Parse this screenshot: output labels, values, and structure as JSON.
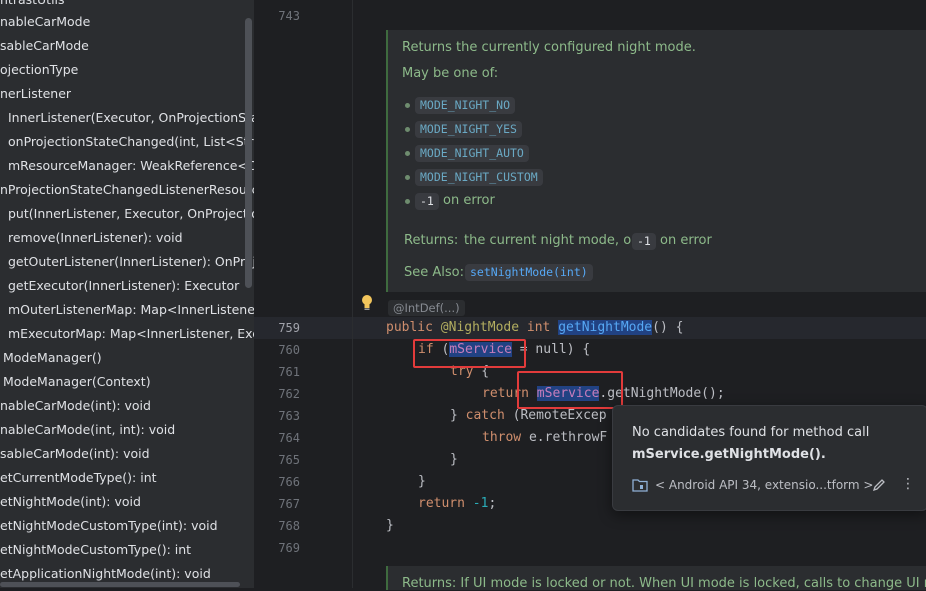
{
  "structure": {
    "items": [
      "ntrastUtils",
      "nableCarMode",
      "sableCarMode",
      "ojectionType",
      "nerListener",
      "InnerListener(Executor, OnProjectionStateC",
      "onProjectionStateChanged(int, List<String>",
      "mResourceManager: WeakReference<OnP",
      "nProjectionStateChangedListenerResourceM",
      "put(InnerListener, Executor, OnProjectionSt",
      "remove(InnerListener): void",
      "getOuterListener(InnerListener): OnProjecti",
      "getExecutor(InnerListener): Executor",
      "mOuterListenerMap: Map<InnerListener, C",
      "mExecutorMap: Map<InnerListener, Execu",
      "ModeManager()",
      "ModeManager(Context)",
      "nableCarMode(int): void",
      "nableCarMode(int, int): void",
      "sableCarMode(int): void",
      "etCurrentModeType(): int",
      "etNightMode(int): void",
      "etNightModeCustomType(int): void",
      "etNightModeCustomType(): int",
      "etApplicationNightMode(int): void"
    ]
  },
  "editor": {
    "line_numbers": [
      "743",
      "759",
      "760",
      "761",
      "762",
      "763",
      "764",
      "765",
      "766",
      "767",
      "768",
      "769"
    ],
    "doc": {
      "summary": "Returns the currently configured night mode.",
      "may_be": "May be one of:",
      "options": [
        "MODE_NIGHT_NO",
        "MODE_NIGHT_YES",
        "MODE_NIGHT_AUTO",
        "MODE_NIGHT_CUSTOM"
      ],
      "error_value": "-1",
      "error_text": "on error",
      "returns_label": "Returns:",
      "returns_text": "the current night mode, or",
      "returns_value": "-1",
      "returns_tail": "on error",
      "see_also_label": "See Also:",
      "see_also_link": "setNightMode(int)"
    },
    "annotation_hint": "@IntDef(...)",
    "code": {
      "l759": {
        "kw1": "public",
        "ann": "@NightMode",
        "kw2": "int",
        "fn": "getNightMode",
        "tail": "() {"
      },
      "l760": {
        "kw": "if",
        "open": " (",
        "field": "mService",
        "tail": " = null) {"
      },
      "l761": {
        "kw": "try",
        "tail": " {"
      },
      "l762": {
        "kw": "return",
        "field": "mService",
        "tail": ".getNightMode();"
      },
      "l763": {
        "head": "} ",
        "kw": "catch",
        "tail": " (RemoteExcep"
      },
      "l764": {
        "kw": "throw",
        "tail": " e.rethrowF"
      },
      "l765": "}",
      "l766": "}",
      "l767": {
        "kw": "return",
        "num": "-1",
        "tail": ";"
      },
      "l768": "}"
    },
    "doc_bottom": "Returns: If UI mode is locked or not. When UI mode is locked, calls to change UI mod"
  },
  "popup": {
    "message": "No candidates found for method call",
    "call": "mService.getNightMode().",
    "library": "< Android API 34, extensio...tform >"
  },
  "colors": {
    "highlight_box": "#e23b3b",
    "keyword": "#cf8e6d",
    "doc_text": "#8dba8a"
  }
}
